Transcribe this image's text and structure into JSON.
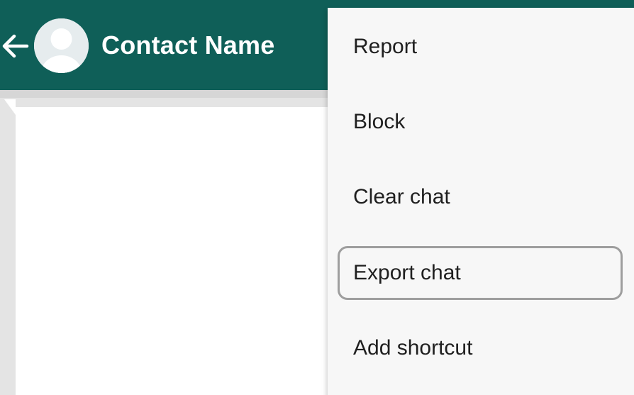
{
  "header": {
    "contact_name": "Contact Name",
    "back_icon": "arrow-left-icon",
    "avatar_icon": "default-avatar-icon"
  },
  "menu": {
    "items": [
      {
        "label": "Report"
      },
      {
        "label": "Block"
      },
      {
        "label": "Clear chat"
      },
      {
        "label": "Export chat",
        "highlighted": true
      },
      {
        "label": "Add shortcut"
      }
    ]
  },
  "colors": {
    "app_bar": "#0f5f58",
    "chat_background": "#e4e4e4",
    "menu_background": "#f7f7f7",
    "highlight_border": "#9e9e9e",
    "menu_text": "#1f1f1f",
    "header_text": "#ffffff"
  }
}
